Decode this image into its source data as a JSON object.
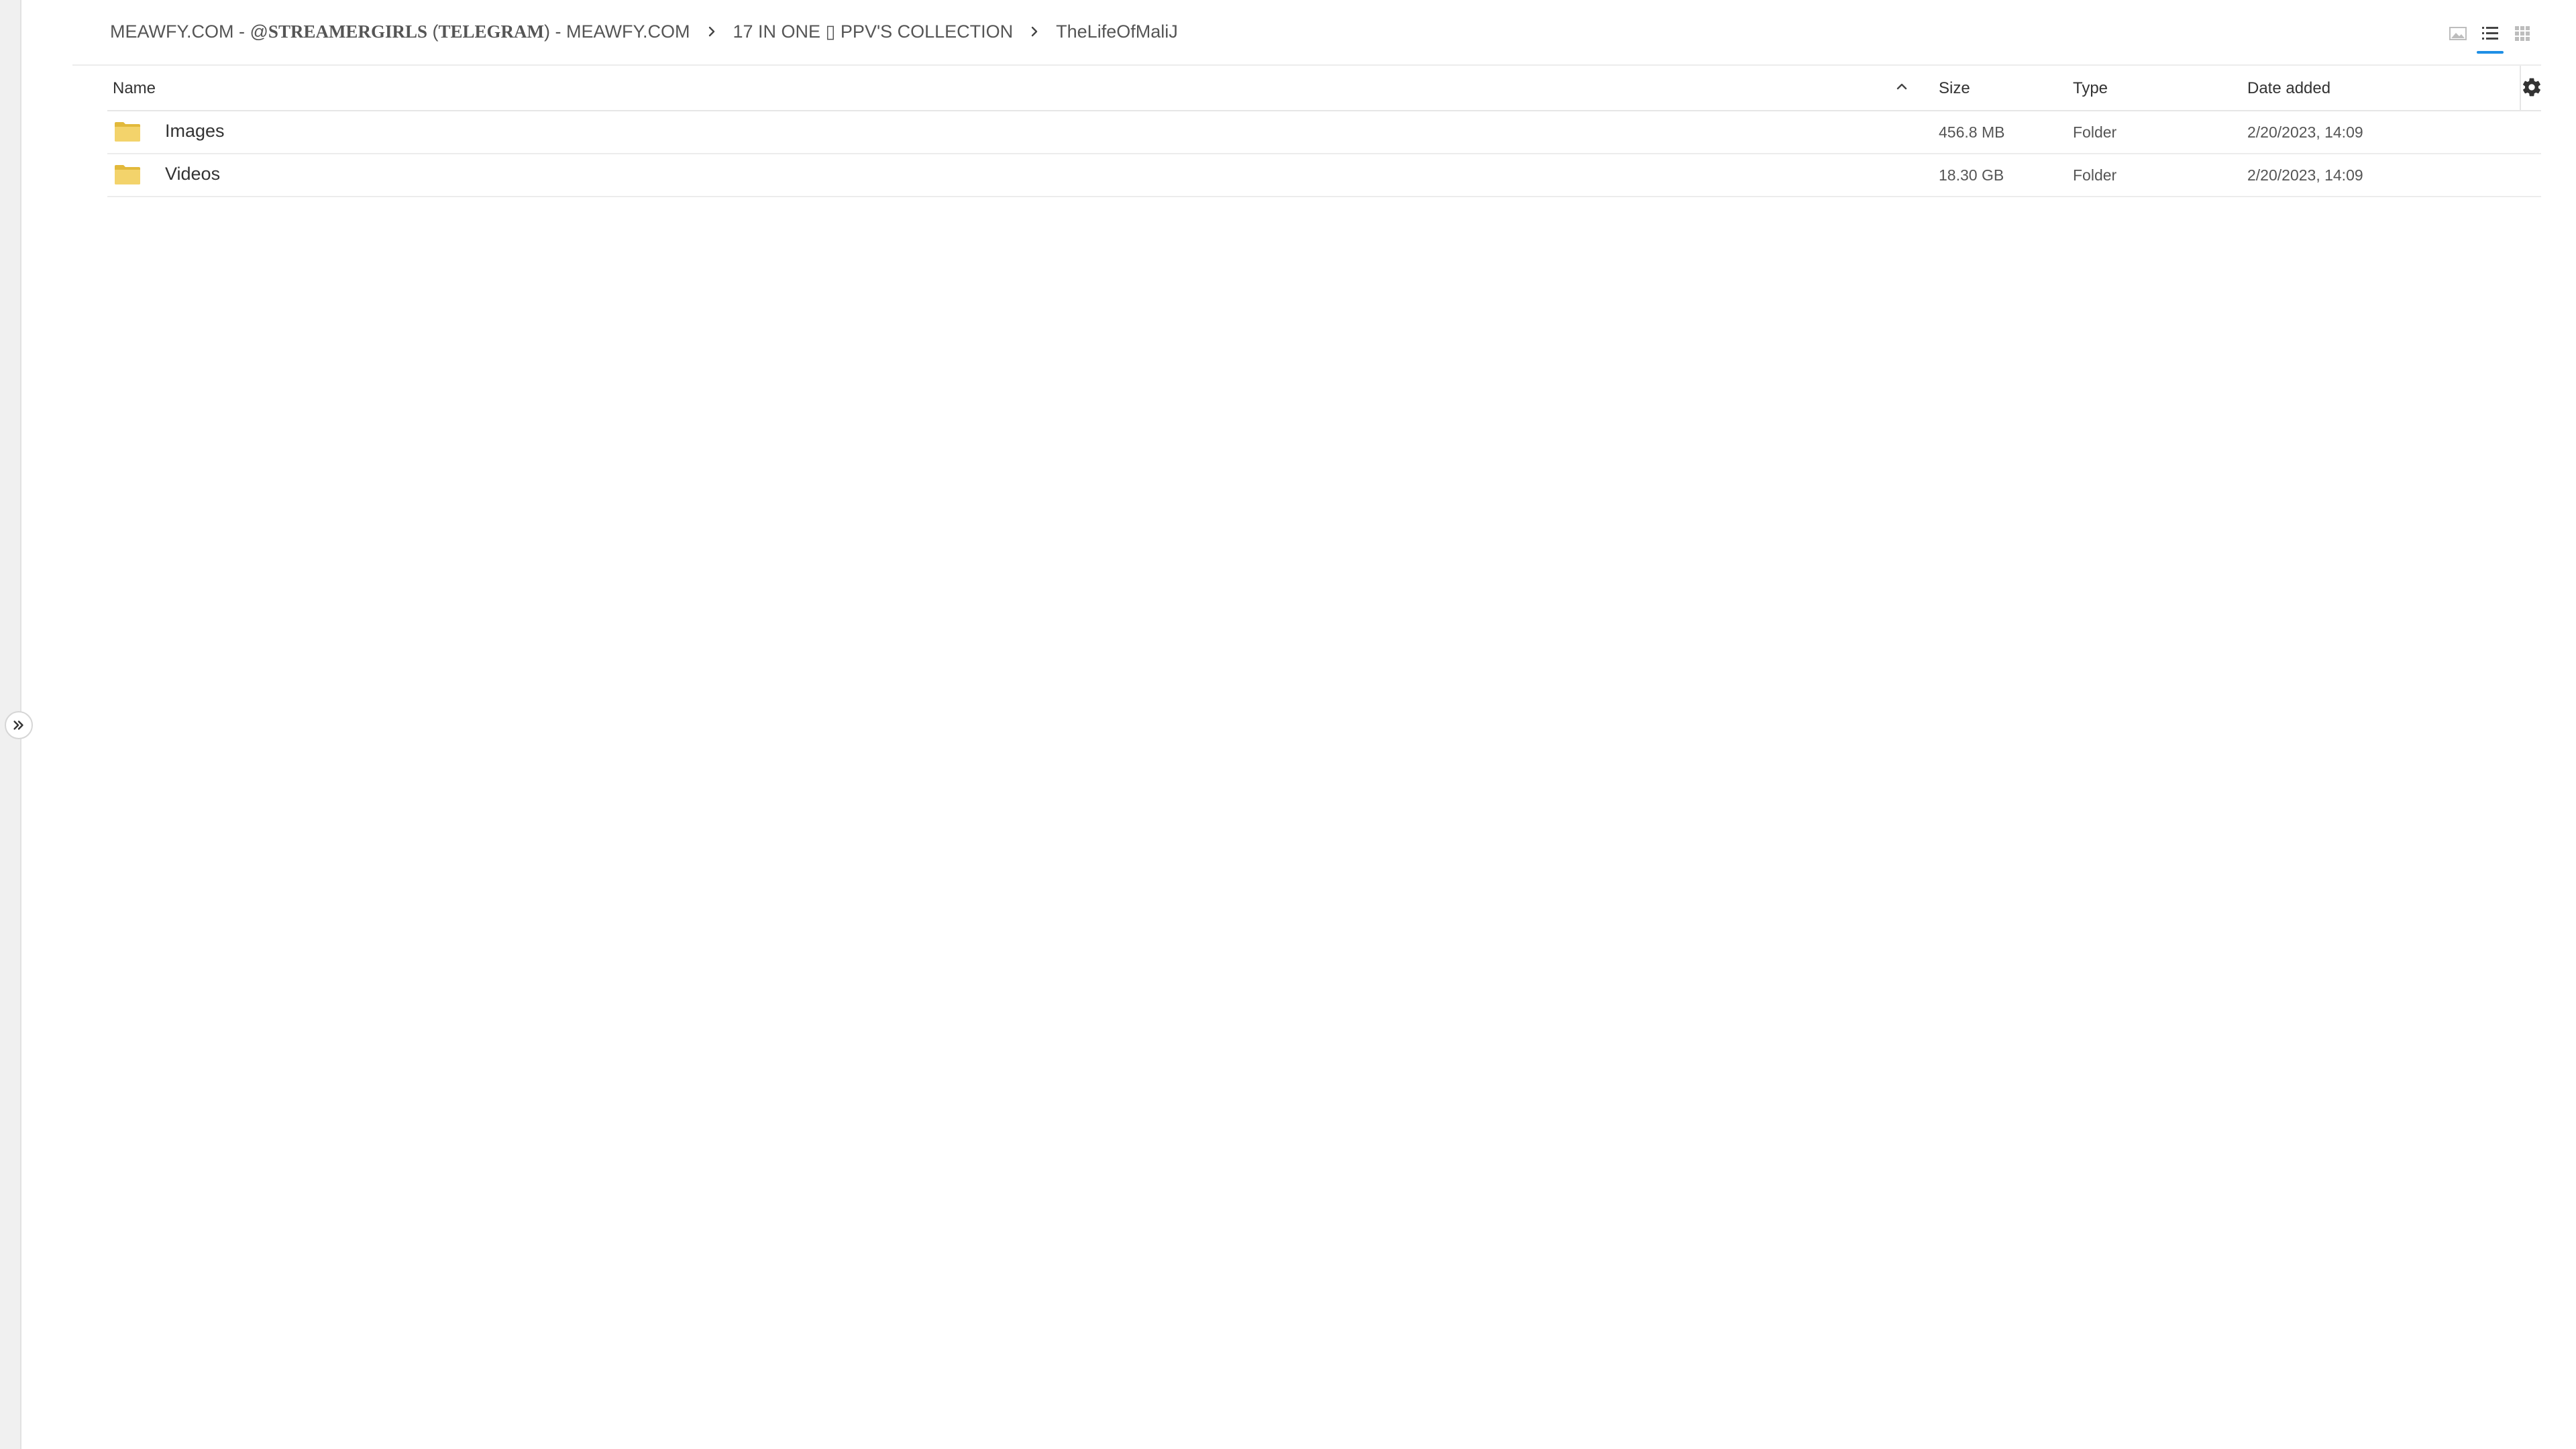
{
  "breadcrumb": {
    "items": [
      {
        "pre": "MEAWFY.COM - @",
        "bold": "STREAMERGIRLS",
        "mid": " (",
        "bold2": "TELEGRAM",
        "post": ") - MEAWFY.COM"
      },
      {
        "label": "17 IN ONE ▯ PPV'S COLLECTION"
      },
      {
        "label": "TheLifeOfMaliJ"
      }
    ]
  },
  "view_switch": {
    "modes": [
      "gallery-icon",
      "list-icon",
      "grid-icon"
    ],
    "active": "list-icon"
  },
  "table": {
    "headers": {
      "name": "Name",
      "size": "Size",
      "type": "Type",
      "date": "Date added"
    },
    "rows": [
      {
        "name": "Images",
        "size": "456.8 MB",
        "type": "Folder",
        "date": "2/20/2023, 14:09"
      },
      {
        "name": "Videos",
        "size": "18.30 GB",
        "type": "Folder",
        "date": "2/20/2023, 14:09"
      }
    ]
  },
  "colors": {
    "accent": "#1f8fe5",
    "folder": "#f3d36b",
    "folder_dark": "#e2b93b"
  }
}
